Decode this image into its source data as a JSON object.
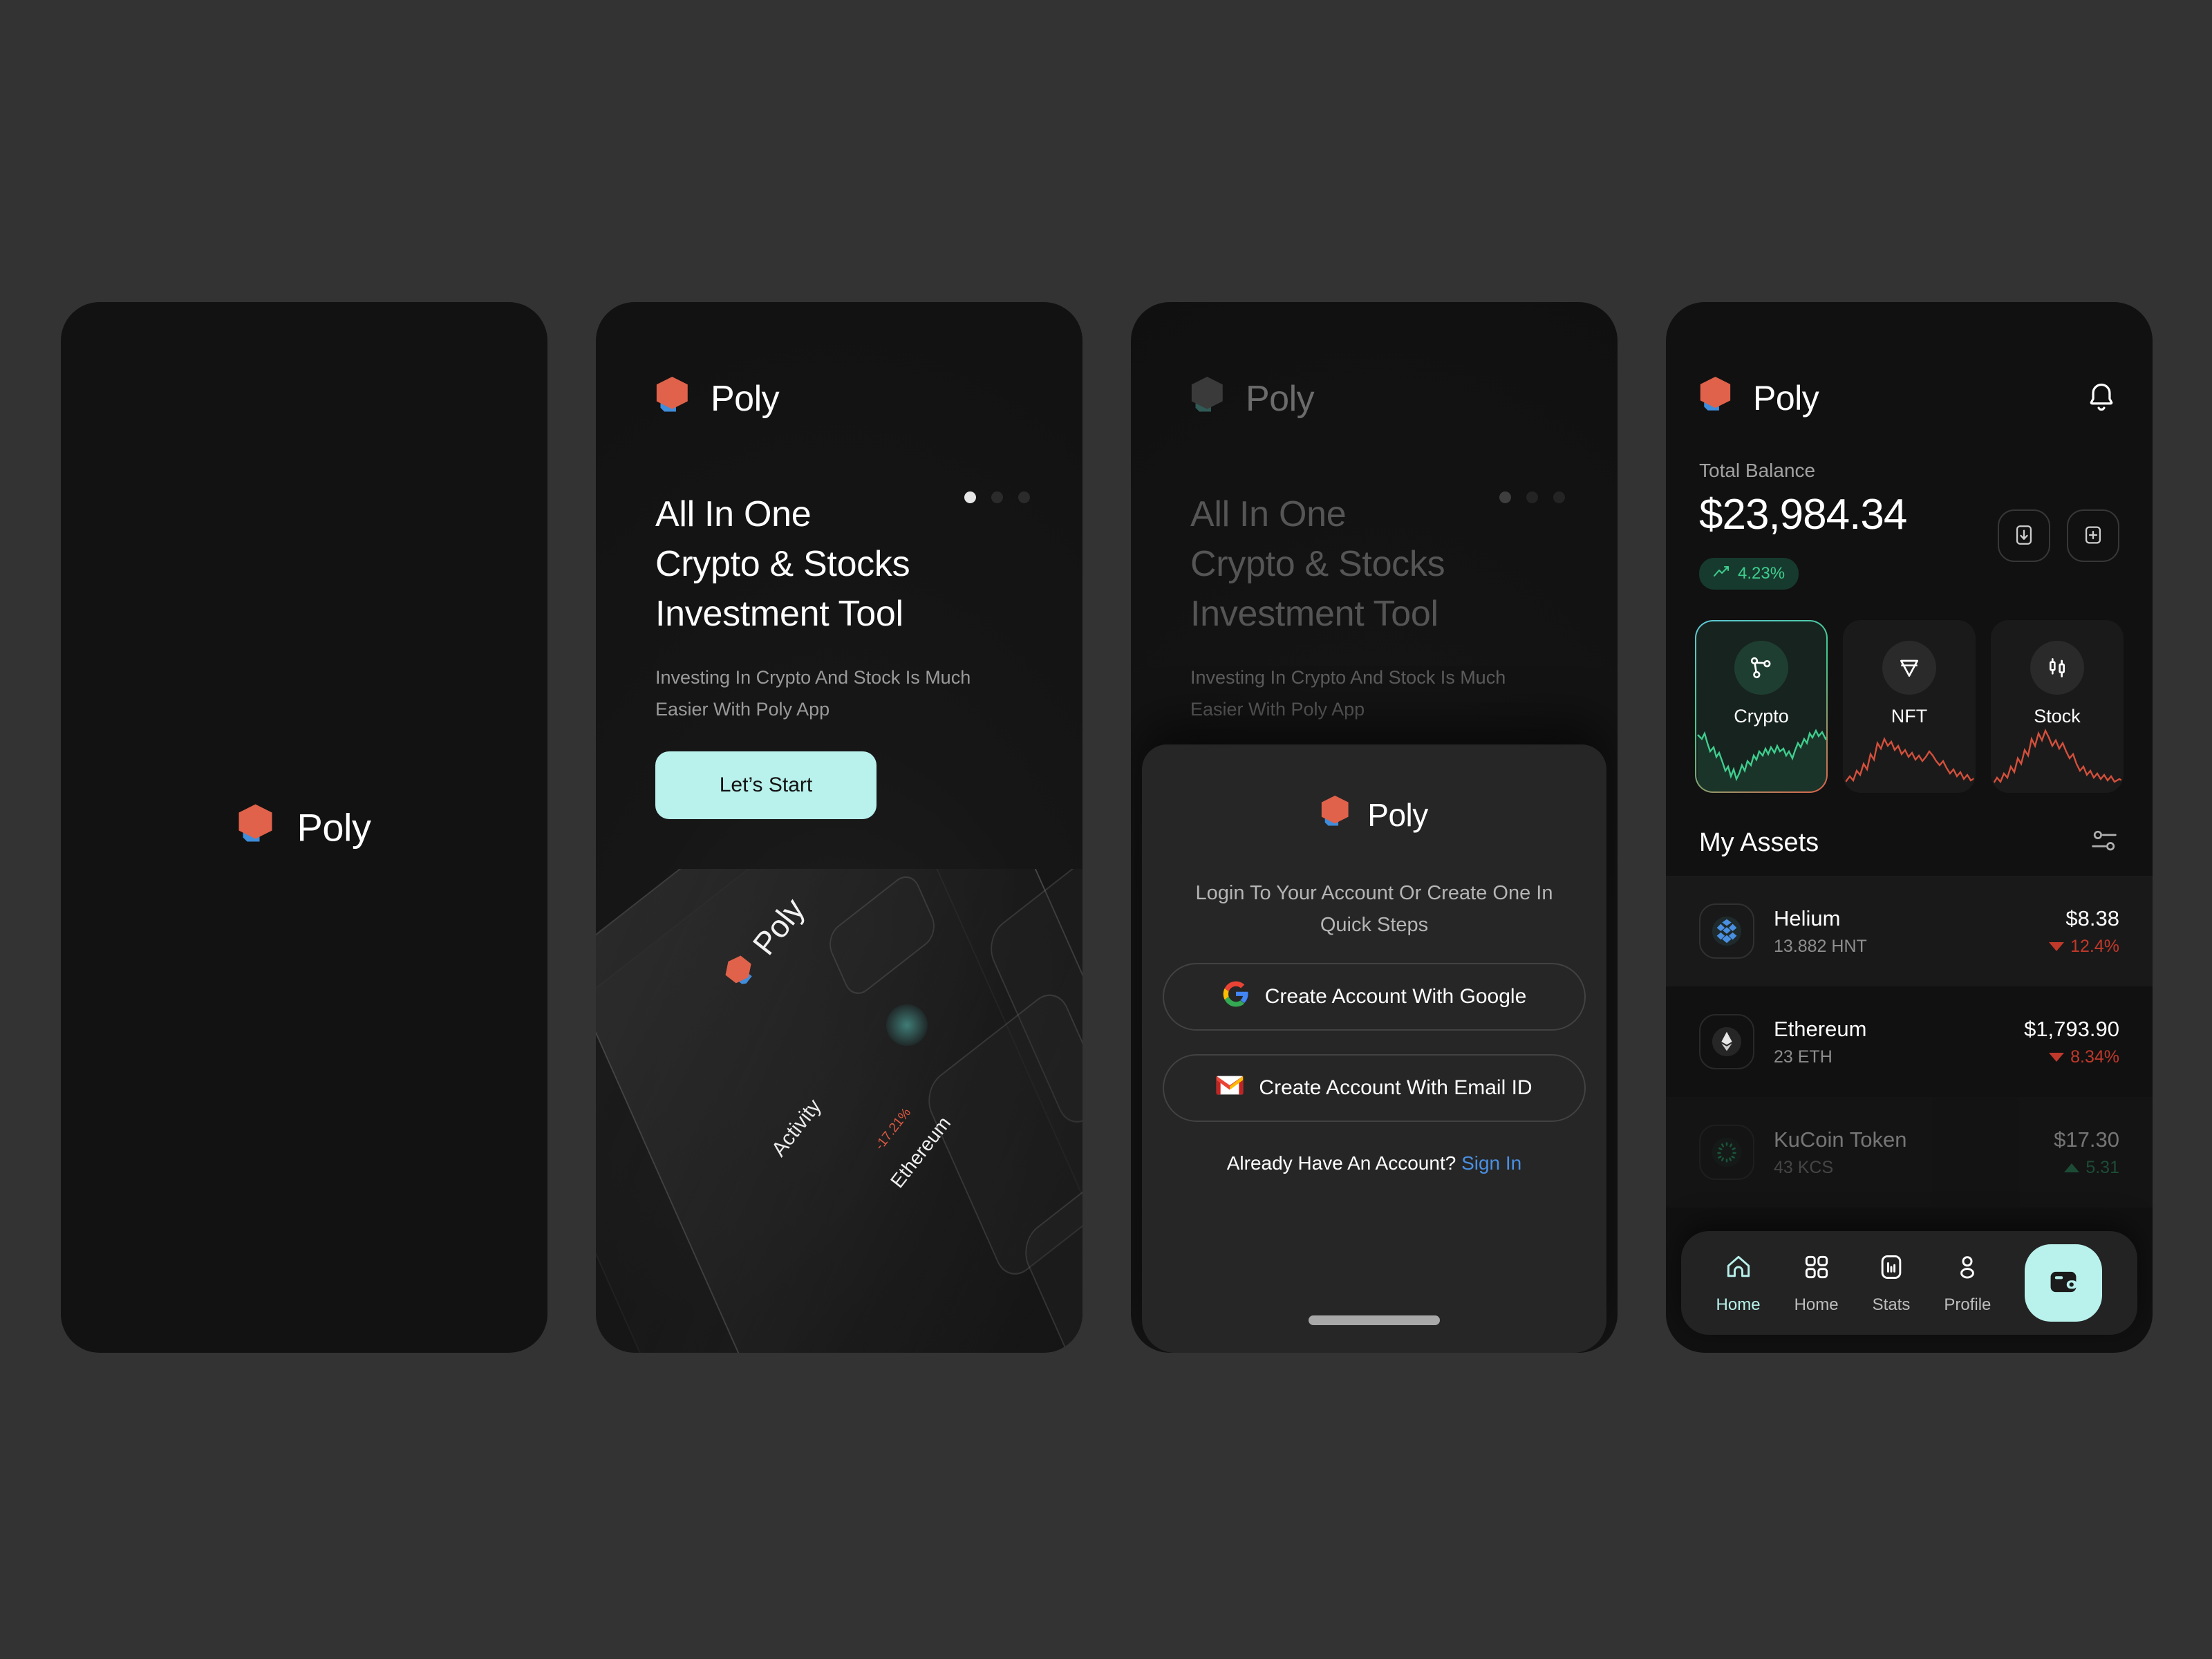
{
  "brand": {
    "name": "Poly",
    "mark_red": "#e0624a",
    "mark_blue": "#3f8ddb",
    "accent_mint": "#b9f1ec"
  },
  "screen1": {
    "logo_text": "Poly"
  },
  "onboarding": {
    "logo_text": "Poly",
    "headline_lines": [
      "All In One",
      "Crypto & Stocks",
      "Investment Tool"
    ],
    "subtitle_lines": [
      "Investing In Crypto And Stock Is Much",
      "Easier With Poly App"
    ],
    "cta_label": "Let’s Start",
    "pagination": {
      "total": 3,
      "active_index": 0
    },
    "mockup": {
      "logo_text": "Poly",
      "activity_label": "Activity",
      "asset_label": "Ethereum",
      "asset_change": "-17.21%"
    }
  },
  "login_sheet": {
    "logo_text": "Poly",
    "subtitle": "Login To Your Account Or Create One In Quick Steps",
    "google_button": "Create Account With Google",
    "email_button": "Create Account With Email ID",
    "footer_text": "Already Have An Account?",
    "footer_link": "Sign In",
    "link_color": "#4a90e2"
  },
  "dashboard": {
    "logo_text": "Poly",
    "balance_label": "Total Balance",
    "balance_amount": "$23,984.34",
    "balance_change": "4.23%",
    "balance_change_color": "#3fce8e",
    "categories": [
      {
        "label": "Crypto",
        "icon": "network-icon",
        "active": true,
        "spark_color": "#3fce8e"
      },
      {
        "label": "NFT",
        "icon": "diamond-icon",
        "active": false,
        "spark_color": "#d4503c"
      },
      {
        "label": "Stock",
        "icon": "candlestick-icon",
        "active": false,
        "spark_color": "#d4503c"
      }
    ],
    "assets_title": "My Assets",
    "assets": [
      {
        "name": "Helium",
        "qty": "13.882 HNT",
        "price": "$8.38",
        "change": "12.4%",
        "direction": "down",
        "icon": "helium-icon"
      },
      {
        "name": "Ethereum",
        "qty": "23 ETH",
        "price": "$1,793.90",
        "change": "8.34%",
        "direction": "down",
        "icon": "ethereum-icon"
      },
      {
        "name": "KuCoin Token",
        "qty": "43 KCS",
        "price": "$17.30",
        "change": "5.31",
        "direction": "up",
        "icon": "kucoin-icon"
      }
    ],
    "nav": [
      {
        "label": "Home",
        "icon": "house-icon",
        "active": true
      },
      {
        "label": "Home",
        "icon": "grid-icon",
        "active": false
      },
      {
        "label": "Stats",
        "icon": "chart-icon",
        "active": false
      },
      {
        "label": "Profile",
        "icon": "person-icon",
        "active": false
      }
    ],
    "fab_icon": "wallet-icon"
  }
}
